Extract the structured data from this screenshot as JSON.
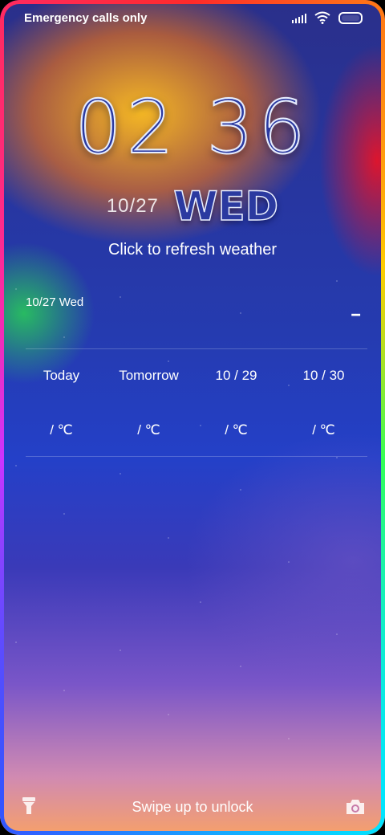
{
  "status_bar": {
    "carrier_text": "Emergency calls only",
    "icons": [
      "signal-icon",
      "wifi-icon",
      "battery-icon"
    ]
  },
  "clock": {
    "time": "02 36",
    "date": "10/27",
    "weekday": "WED"
  },
  "weather": {
    "refresh_text": "Click to refresh weather",
    "date_label": "10/27  Wed",
    "current_temp": "--",
    "forecast": [
      {
        "day": "Today",
        "temp": "/ ℃"
      },
      {
        "day": "Tomorrow",
        "temp": "/ ℃"
      },
      {
        "day": "10 / 29",
        "temp": "/ ℃"
      },
      {
        "day": "10 / 30",
        "temp": "/ ℃"
      }
    ]
  },
  "bottom": {
    "unlock_text": "Swipe up to unlock",
    "left_icon": "flashlight-icon",
    "right_icon": "camera-icon"
  }
}
